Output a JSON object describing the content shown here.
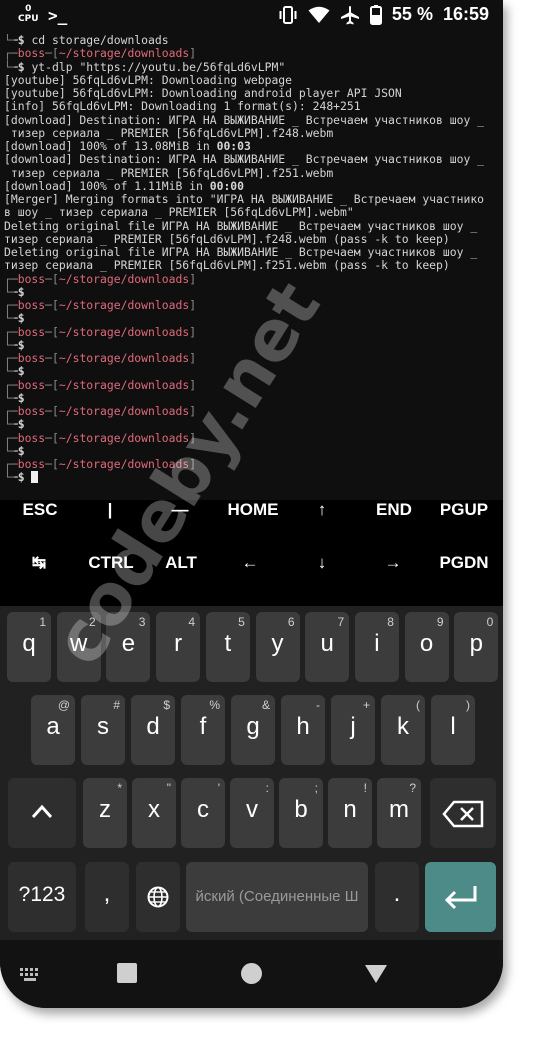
{
  "status_bar": {
    "cpu_digit": "0",
    "cpu_label": "CPU",
    "battery": "55 %",
    "time": "16:59",
    "icons": [
      "vibrate-icon",
      "wifi-icon",
      "airplane-icon",
      "battery-icon"
    ]
  },
  "terminal": {
    "lines": [
      {
        "segs": [
          {
            "t": "└╼",
            "c": "gray"
          },
          {
            "t": "$ ",
            "c": "bold"
          },
          {
            "t": "cd storage/downloads"
          }
        ]
      },
      {
        "segs": [
          {
            "t": "┌─",
            "c": "gray"
          },
          {
            "t": "boss",
            "c": "pink"
          },
          {
            "t": "─[",
            "c": "gray"
          },
          {
            "t": "~/storage/downloads",
            "c": "pink"
          },
          {
            "t": "]",
            "c": "gray"
          }
        ]
      },
      {
        "segs": [
          {
            "t": "└╼",
            "c": "gray"
          },
          {
            "t": "$ ",
            "c": "bold"
          },
          {
            "t": "yt-dlp \"https://youtu.be/56fqLd6vLPM\""
          }
        ]
      },
      {
        "segs": [
          {
            "t": "[youtube] 56fqLd6vLPM: Downloading webpage"
          }
        ]
      },
      {
        "segs": [
          {
            "t": "[youtube] 56fqLd6vLPM: Downloading android player API JSON"
          }
        ]
      },
      {
        "segs": [
          {
            "t": "[info] 56fqLd6vLPM: Downloading 1 format(s): 248+251"
          }
        ]
      },
      {
        "segs": [
          {
            "t": "[download] Destination: ИГРА НА ВЫЖИВАНИЕ _ Встречаем участников шоу _"
          }
        ]
      },
      {
        "segs": [
          {
            "t": " тизер сериала _ PREMIER [56fqLd6vLPM].f248.webm"
          }
        ]
      },
      {
        "segs": [
          {
            "t": "[download] 100% of 13.08MiB in "
          },
          {
            "t": "00:03",
            "c": "bold"
          }
        ]
      },
      {
        "segs": [
          {
            "t": "[download] Destination: ИГРА НА ВЫЖИВАНИЕ _ Встречаем участников шоу _"
          }
        ]
      },
      {
        "segs": [
          {
            "t": " тизер сериала _ PREMIER [56fqLd6vLPM].f251.webm"
          }
        ]
      },
      {
        "segs": [
          {
            "t": "[download] 100% of 1.11MiB in "
          },
          {
            "t": "00:00",
            "c": "bold"
          }
        ]
      },
      {
        "segs": [
          {
            "t": "[Merger] Merging formats into \"ИГРА НА ВЫЖИВАНИЕ _ Встречаем участнико"
          }
        ]
      },
      {
        "segs": [
          {
            "t": "в шоу _ тизер сериала _ PREMIER [56fqLd6vLPM].webm\""
          }
        ]
      },
      {
        "segs": [
          {
            "t": "Deleting original file ИГРА НА ВЫЖИВАНИЕ _ Встречаем участников шоу _"
          }
        ]
      },
      {
        "segs": [
          {
            "t": "тизер сериала _ PREMIER [56fqLd6vLPM].f248.webm (pass -k to keep)"
          }
        ]
      },
      {
        "segs": [
          {
            "t": "Deleting original file ИГРА НА ВЫЖИВАНИЕ _ Встречаем участников шоу _"
          }
        ]
      },
      {
        "segs": [
          {
            "t": "тизер сериала _ PREMIER [56fqLd6vLPM].f251.webm (pass -k to keep)"
          }
        ]
      },
      {
        "segs": [
          {
            "t": "┌─",
            "c": "gray"
          },
          {
            "t": "boss",
            "c": "pink"
          },
          {
            "t": "─[",
            "c": "gray"
          },
          {
            "t": "~/storage/downloads",
            "c": "pink"
          },
          {
            "t": "]",
            "c": "gray"
          }
        ]
      },
      {
        "segs": [
          {
            "t": "└╼",
            "c": "gray"
          },
          {
            "t": "$",
            "c": "bold"
          }
        ]
      },
      {
        "segs": [
          {
            "t": "┌─",
            "c": "gray"
          },
          {
            "t": "boss",
            "c": "pink"
          },
          {
            "t": "─[",
            "c": "gray"
          },
          {
            "t": "~/storage/downloads",
            "c": "pink"
          },
          {
            "t": "]",
            "c": "gray"
          }
        ]
      },
      {
        "segs": [
          {
            "t": "└╼",
            "c": "gray"
          },
          {
            "t": "$",
            "c": "bold"
          }
        ]
      },
      {
        "segs": [
          {
            "t": "┌─",
            "c": "gray"
          },
          {
            "t": "boss",
            "c": "pink"
          },
          {
            "t": "─[",
            "c": "gray"
          },
          {
            "t": "~/storage/downloads",
            "c": "pink"
          },
          {
            "t": "]",
            "c": "gray"
          }
        ]
      },
      {
        "segs": [
          {
            "t": "└╼",
            "c": "gray"
          },
          {
            "t": "$",
            "c": "bold"
          }
        ]
      },
      {
        "segs": [
          {
            "t": "┌─",
            "c": "gray"
          },
          {
            "t": "boss",
            "c": "pink"
          },
          {
            "t": "─[",
            "c": "gray"
          },
          {
            "t": "~/storage/downloads",
            "c": "pink"
          },
          {
            "t": "]",
            "c": "gray"
          }
        ]
      },
      {
        "segs": [
          {
            "t": "└╼",
            "c": "gray"
          },
          {
            "t": "$",
            "c": "bold"
          }
        ]
      },
      {
        "segs": [
          {
            "t": "┌─",
            "c": "gray"
          },
          {
            "t": "boss",
            "c": "pink"
          },
          {
            "t": "─[",
            "c": "gray"
          },
          {
            "t": "~/storage/downloads",
            "c": "pink"
          },
          {
            "t": "]",
            "c": "gray"
          }
        ]
      },
      {
        "segs": [
          {
            "t": "└╼",
            "c": "gray"
          },
          {
            "t": "$",
            "c": "bold"
          }
        ]
      },
      {
        "segs": [
          {
            "t": "┌─",
            "c": "gray"
          },
          {
            "t": "boss",
            "c": "pink"
          },
          {
            "t": "─[",
            "c": "gray"
          },
          {
            "t": "~/storage/downloads",
            "c": "pink"
          },
          {
            "t": "]",
            "c": "gray"
          }
        ]
      },
      {
        "segs": [
          {
            "t": "└╼",
            "c": "gray"
          },
          {
            "t": "$",
            "c": "bold"
          }
        ]
      },
      {
        "segs": [
          {
            "t": "┌─",
            "c": "gray"
          },
          {
            "t": "boss",
            "c": "pink"
          },
          {
            "t": "─[",
            "c": "gray"
          },
          {
            "t": "~/storage/downloads",
            "c": "pink"
          },
          {
            "t": "]",
            "c": "gray"
          }
        ]
      },
      {
        "segs": [
          {
            "t": "└╼",
            "c": "gray"
          },
          {
            "t": "$",
            "c": "bold"
          }
        ]
      },
      {
        "segs": [
          {
            "t": "┌─",
            "c": "gray"
          },
          {
            "t": "boss",
            "c": "pink"
          },
          {
            "t": "─[",
            "c": "gray"
          },
          {
            "t": "~/storage/downloads",
            "c": "pink"
          },
          {
            "t": "]",
            "c": "gray"
          }
        ]
      },
      {
        "segs": [
          {
            "t": "└╼",
            "c": "gray"
          },
          {
            "t": "$ ",
            "c": "bold"
          },
          {
            "t": "",
            "cursor": true
          }
        ]
      }
    ]
  },
  "extra_keys": {
    "row1": [
      "ESC",
      "|",
      "—",
      "HOME",
      "↑",
      "END",
      "PGUP"
    ],
    "row2": [
      "↹",
      "CTRL",
      "ALT",
      "←",
      "↓",
      "→",
      "PGDN"
    ]
  },
  "keyboard": {
    "row1": [
      {
        "k": "q",
        "s": "1"
      },
      {
        "k": "w",
        "s": "2"
      },
      {
        "k": "e",
        "s": "3"
      },
      {
        "k": "r",
        "s": "4"
      },
      {
        "k": "t",
        "s": "5"
      },
      {
        "k": "y",
        "s": "6"
      },
      {
        "k": "u",
        "s": "7"
      },
      {
        "k": "i",
        "s": "8"
      },
      {
        "k": "o",
        "s": "9"
      },
      {
        "k": "p",
        "s": "0"
      }
    ],
    "row2": [
      {
        "k": "a",
        "s": "@"
      },
      {
        "k": "s",
        "s": "#"
      },
      {
        "k": "d",
        "s": "$"
      },
      {
        "k": "f",
        "s": "%"
      },
      {
        "k": "g",
        "s": "&"
      },
      {
        "k": "h",
        "s": "-"
      },
      {
        "k": "j",
        "s": "+"
      },
      {
        "k": "k",
        "s": "("
      },
      {
        "k": "l",
        "s": ")"
      }
    ],
    "row3": [
      {
        "k": "z",
        "s": "*"
      },
      {
        "k": "x",
        "s": "\""
      },
      {
        "k": "c",
        "s": "'"
      },
      {
        "k": "v",
        "s": ":"
      },
      {
        "k": "b",
        "s": ";"
      },
      {
        "k": "n",
        "s": "!"
      },
      {
        "k": "m",
        "s": "?"
      }
    ],
    "symbols_label": "?123",
    "space_label": "йский (Соединенные Ш",
    "comma": ",",
    "period": ".",
    "accent_color": "#4c8b88"
  }
}
